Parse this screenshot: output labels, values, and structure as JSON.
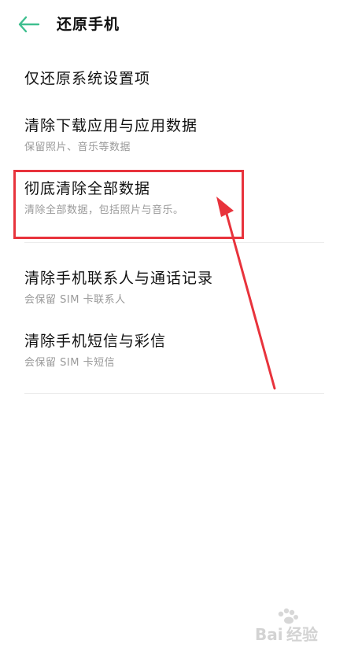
{
  "header": {
    "title": "还原手机",
    "back_icon": "arrow-left-icon",
    "accent_color": "#3fbf8f"
  },
  "options": [
    {
      "title": "仅还原系统设置项",
      "subtitle": ""
    },
    {
      "title": "清除下载应用与应用数据",
      "subtitle": "保留照片、音乐等数据"
    },
    {
      "title": "彻底清除全部数据",
      "subtitle": "清除全部数据，包括照片与音乐。"
    },
    {
      "title": "清除手机联系人与通话记录",
      "subtitle": "会保留 SIM 卡联系人"
    },
    {
      "title": "清除手机短信与彩信",
      "subtitle": "会保留 SIM 卡短信"
    }
  ],
  "annotation": {
    "color": "#e8333c"
  },
  "watermark": {
    "brand": "Bai经验",
    "icon": "paw-logo-icon"
  }
}
